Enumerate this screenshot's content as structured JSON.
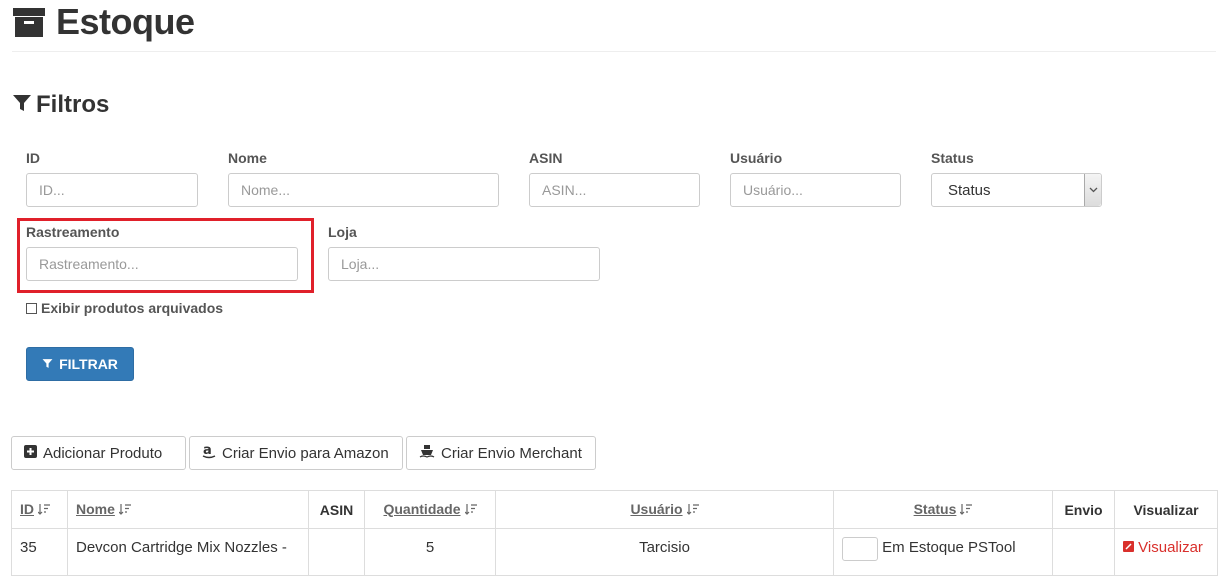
{
  "page": {
    "title": "Estoque",
    "title_icon": "archive-icon"
  },
  "filters": {
    "title": "Filtros",
    "fields": {
      "id": {
        "label": "ID",
        "placeholder": "ID..."
      },
      "nome": {
        "label": "Nome",
        "placeholder": "Nome..."
      },
      "asin": {
        "label": "ASIN",
        "placeholder": "ASIN..."
      },
      "usuario": {
        "label": "Usuário",
        "placeholder": "Usuário..."
      },
      "status": {
        "label": "Status",
        "value": "Status"
      },
      "rastreamento": {
        "label": "Rastreamento",
        "placeholder": "Rastreamento..."
      },
      "loja": {
        "label": "Loja",
        "placeholder": "Loja..."
      }
    },
    "archived_checkbox": {
      "label": "Exibir produtos arquivados",
      "checked": false
    },
    "submit_label": "FILTRAR"
  },
  "actions": {
    "add_product": "Adicionar Produto",
    "create_amazon_shipment": "Criar Envio para Amazon",
    "create_merchant_shipment": "Criar Envio Merchant"
  },
  "table": {
    "headers": {
      "id": "ID",
      "nome": "Nome",
      "asin": "ASIN",
      "quantidade": "Quantidade",
      "usuario": "Usuário",
      "status": "Status",
      "envio": "Envio",
      "visualizar": "Visualizar"
    },
    "rows": [
      {
        "id": "35",
        "nome": "Devcon Cartridge Mix Nozzles -",
        "asin": "",
        "quantidade": "5",
        "usuario": "Tarcisio",
        "status": "Em Estoque PSTool",
        "envio": "",
        "visualizar": "Visualizar"
      }
    ]
  },
  "colors": {
    "primary": "#337ab7",
    "highlight": "#e0202a",
    "link_red": "#d9302c"
  }
}
